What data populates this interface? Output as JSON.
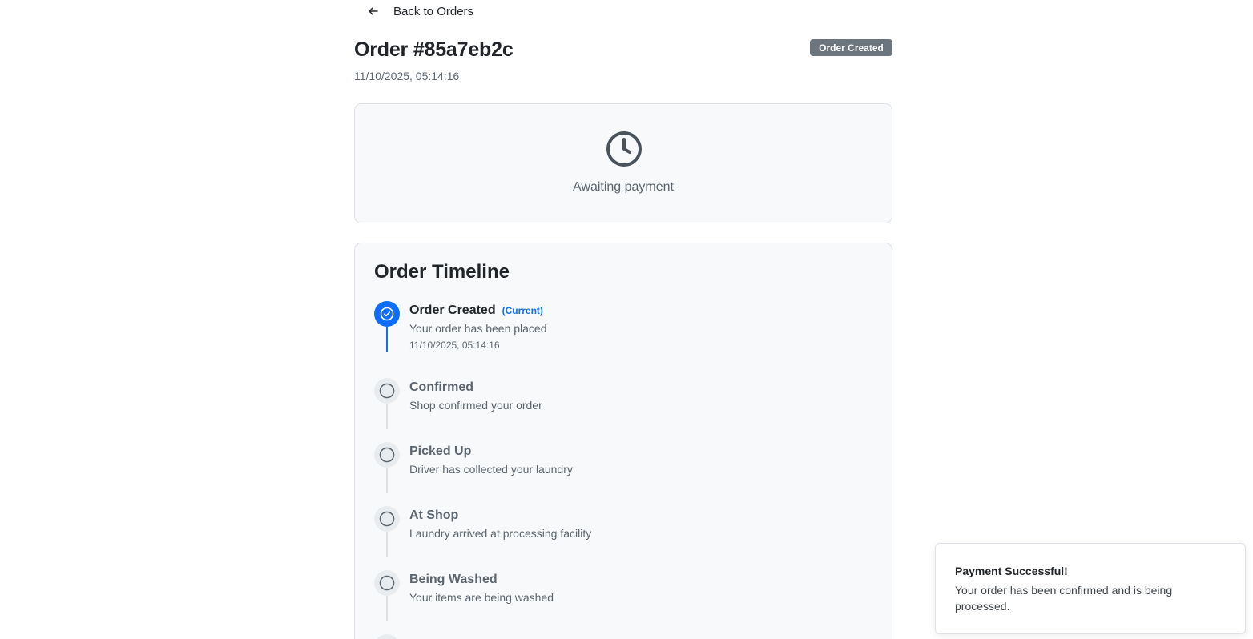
{
  "nav": {
    "back_label": "Back to Orders"
  },
  "order": {
    "title": "Order #85a7eb2c",
    "date": "11/10/2025, 05:14:16",
    "status_badge": "Order Created"
  },
  "status_card": {
    "text": "Awaiting payment"
  },
  "timeline": {
    "title": "Order Timeline",
    "steps": [
      {
        "title": "Order Created",
        "tag": "(Current)",
        "description": "Your order has been placed",
        "time": "11/10/2025, 05:14:16"
      },
      {
        "title": "Confirmed",
        "description": "Shop confirmed your order"
      },
      {
        "title": "Picked Up",
        "description": "Driver has collected your laundry"
      },
      {
        "title": "At Shop",
        "description": "Laundry arrived at processing facility"
      },
      {
        "title": "Being Washed",
        "description": "Your items are being washed"
      }
    ]
  },
  "toast": {
    "title": "Payment Successful!",
    "message": "Your order has been confirmed and is being processed."
  },
  "colors": {
    "primary": "#0d6efd",
    "badge_bg": "#6c757d",
    "muted_text": "#5b6570",
    "card_bg": "#f8f9fa"
  },
  "icons": {
    "back": "arrow-left-icon",
    "status": "clock-icon",
    "step_done": "check-circle-icon",
    "step_pending": "circle-icon"
  }
}
